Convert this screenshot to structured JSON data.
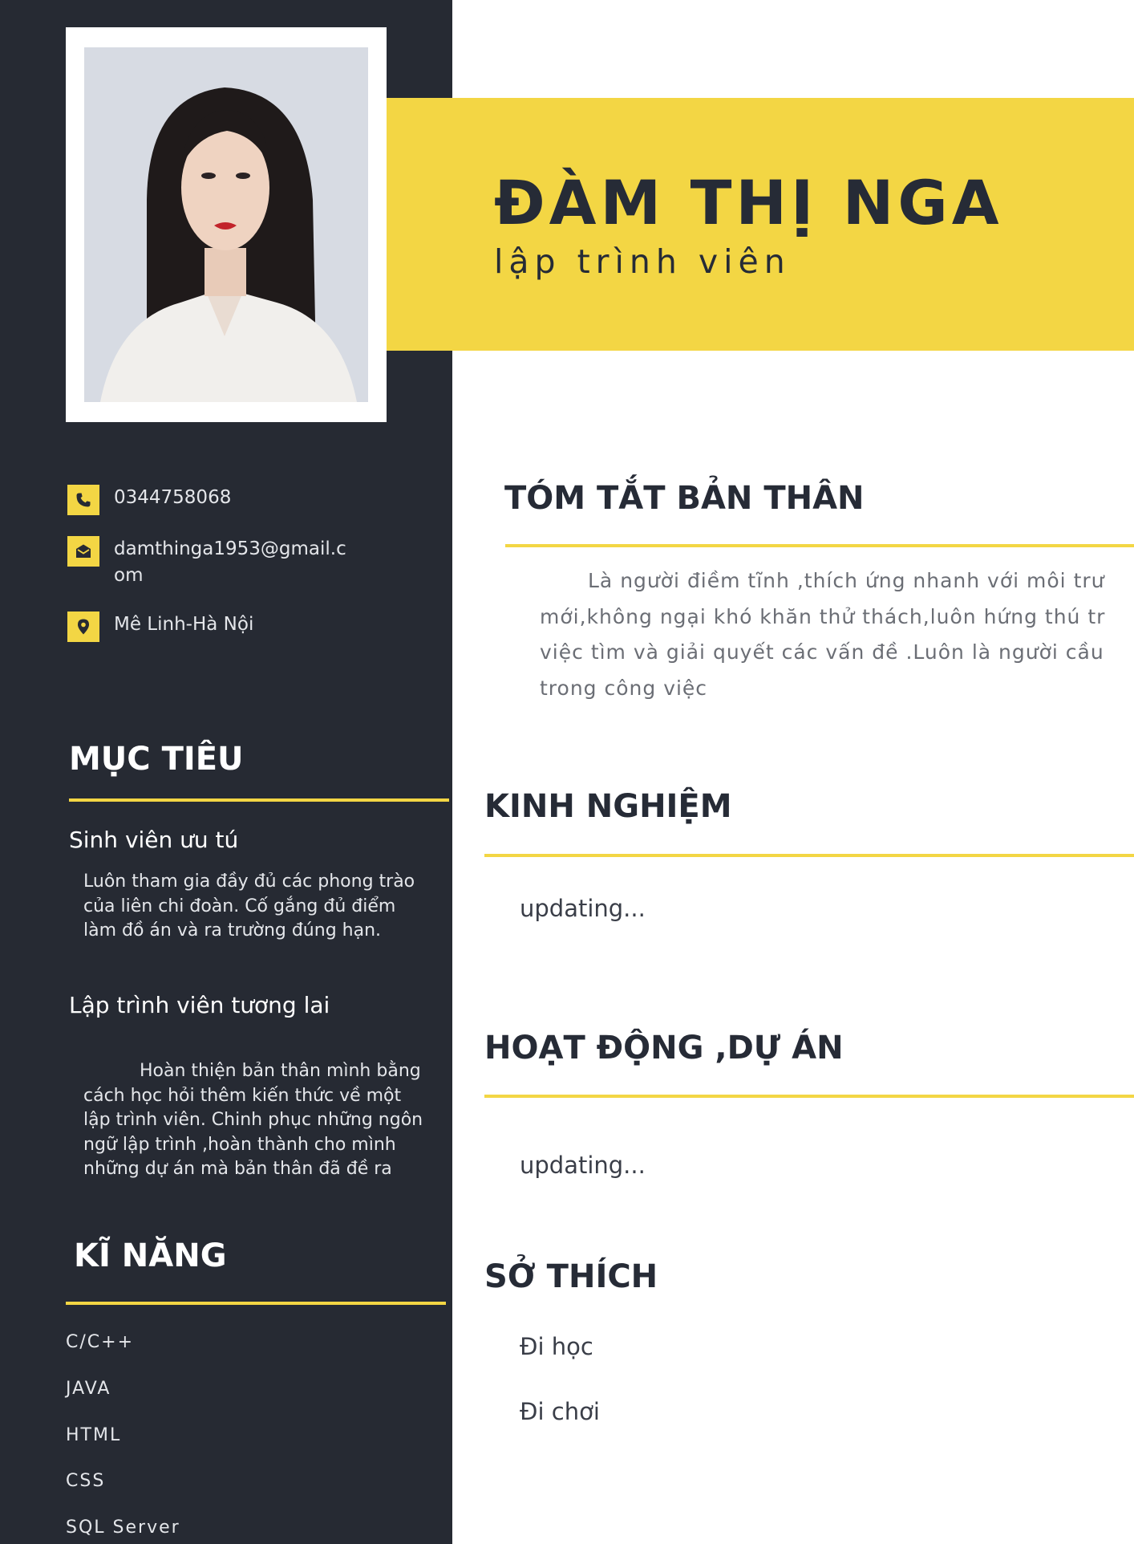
{
  "header": {
    "name": "ĐÀM THỊ NGA",
    "role": "lập trình viên"
  },
  "contact": {
    "phone": "0344758068",
    "email": "damthinga1953@gmail.com",
    "address": "Mê Linh-Hà Nội"
  },
  "objectives": {
    "heading": "MỤC TIÊU",
    "items": [
      {
        "title": "Sinh viên ưu tú",
        "text": "Luôn tham gia đầy đủ các phong trào của liên chi đoàn. Cố gắng đủ điểm làm đồ án và ra trường đúng hạn."
      },
      {
        "title": "Lập trình viên tương lai",
        "text": "Hoàn thiện bản thân mình bằng cách học hỏi thêm kiến thức về một lập trình viên. Chinh phục những ngôn ngữ lập trình ,hoàn thành cho mình những dự án mà bản thân đã đề ra"
      }
    ]
  },
  "skills": {
    "heading": "KĨ NĂNG",
    "items": [
      "C/C++",
      "JAVA",
      "HTML",
      "CSS",
      "SQL Server"
    ]
  },
  "summary": {
    "heading": "TÓM TẮT BẢN THÂN",
    "lines": [
      "Là người điềm tĩnh ,thích ứng nhanh với môi trư",
      "mới,không ngại khó khăn thử thách,luôn hứng thú tr",
      "việc tìm và giải quyết các vấn đề .Luôn là người cầu",
      "trong công việc"
    ]
  },
  "experience": {
    "heading": "KINH NGHIỆM",
    "text": "updating..."
  },
  "activities": {
    "heading": "HOẠT ĐỘNG ,DỰ ÁN",
    "text": "updating..."
  },
  "hobbies": {
    "heading": "SỞ THÍCH",
    "items": [
      "Đi học",
      "Đi chơi"
    ]
  },
  "colors": {
    "sidebar": "#262a33",
    "accent": "#f3d644",
    "heading_dark": "#262b36"
  }
}
